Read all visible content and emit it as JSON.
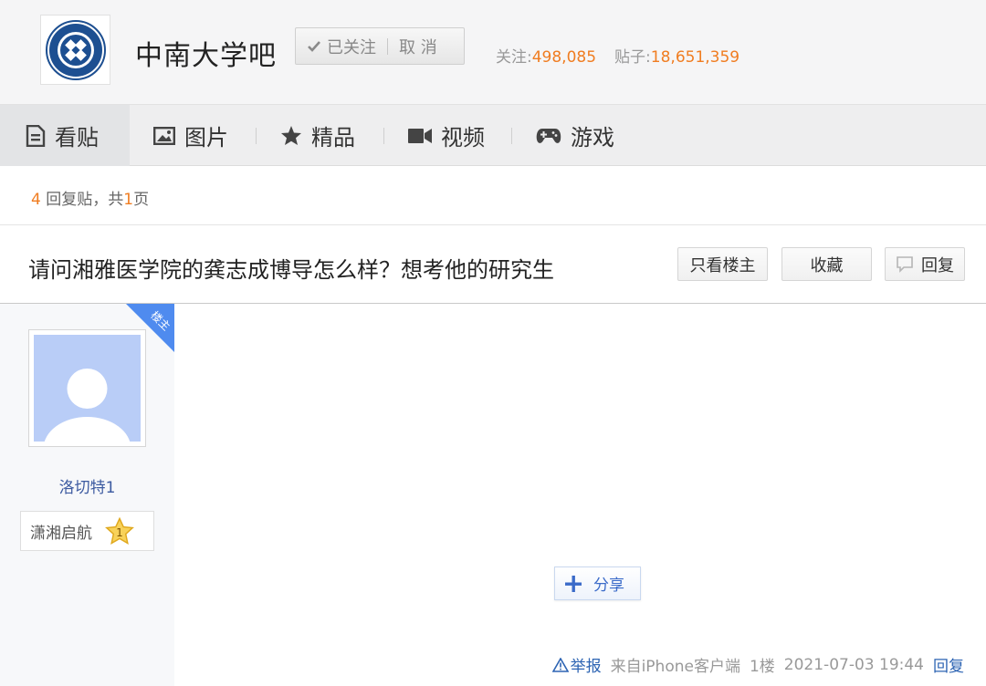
{
  "forum": {
    "name": "中南大学吧",
    "follow": {
      "followed_label": "已关注",
      "cancel_label": "取 消"
    },
    "stats": {
      "followers_label": "关注:",
      "followers_value": "498,085",
      "posts_label": "贴子:",
      "posts_value": "18,651,359"
    }
  },
  "nav": {
    "items": [
      {
        "label": "看贴",
        "icon": "document-icon",
        "active": true
      },
      {
        "label": "图片",
        "icon": "image-icon"
      },
      {
        "label": "精品",
        "icon": "star-icon"
      },
      {
        "label": "视频",
        "icon": "video-camera-icon"
      },
      {
        "label": "游戏",
        "icon": "gamepad-icon"
      }
    ]
  },
  "pager": {
    "reply_count": "4",
    "reply_text": "回复贴，共",
    "page_count": "1",
    "page_suffix": "页"
  },
  "thread": {
    "title": "请问湘雅医学院的龚志成博导怎么样？想考他的研究生",
    "buttons": {
      "only_op": "只看楼主",
      "favorite": "收藏",
      "reply": "回复"
    }
  },
  "post": {
    "op_tag": "楼主",
    "author": {
      "name": "洛切特1",
      "badge_name": "潇湘启航",
      "level": "1"
    },
    "share_label": "分享",
    "footer": {
      "report": "举报",
      "source": "来自iPhone客户端",
      "floor": "1楼",
      "time": "2021-07-03 19:44",
      "reply": "回复"
    }
  },
  "colors": {
    "accent": "#f07d21",
    "link": "#2d64b3",
    "op_tag": "#4f8bef"
  }
}
